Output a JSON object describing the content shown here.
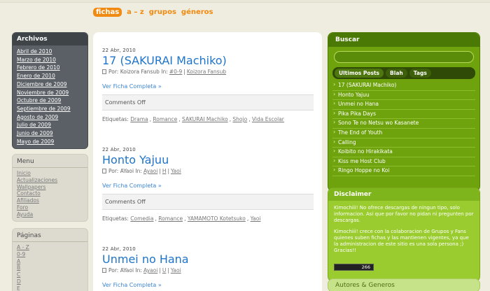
{
  "nav": [
    "fichas",
    "a – z",
    "grupos",
    "géneros"
  ],
  "archivos": {
    "title": "Archivos",
    "items": [
      "Abril de 2010",
      "Marzo de 2010",
      "Febrero de 2010",
      "Enero de 2010",
      "Diciembre de 2009",
      "Noviembre de 2009",
      "Octubre de 2009",
      "Septiembre de 2009",
      "Agosto de 2009",
      "Julio de 2009",
      "Junio de 2009",
      "Mayo de 2009"
    ]
  },
  "menu": {
    "title": "Menu",
    "items": [
      "Inicio",
      "Actualizaciones",
      "Wallpapers",
      "Contacto",
      "Afiliados",
      "Foro",
      "Ayuda"
    ]
  },
  "paginas": {
    "title": "Páginas",
    "items": [
      "A - Z",
      "0-9",
      "A",
      "B",
      "C",
      "D",
      "E"
    ]
  },
  "posts": [
    {
      "date": "22 Abr, 2010",
      "title": "17 (SAKURAI Machiko)",
      "por": "Por: Koizora Fansub In:",
      "cats": [
        "#0-9",
        "Koizora Fansub"
      ],
      "more": "Ver Ficha Completa »",
      "comments": "Comments Off",
      "etiquetas_label": "Etiquetas:",
      "tags": [
        "Drama",
        "Romance",
        "SAKURAI Machiko",
        "Shojo",
        "Vida Escolar"
      ]
    },
    {
      "date": "22 Abr, 2010",
      "title": "Honto Yajuu",
      "por": "Por: AYaoi In:",
      "cats": [
        "Ayaoi",
        "H",
        "Yaoi"
      ],
      "more": "Ver Ficha Completa »",
      "comments": "Comments Off",
      "etiquetas_label": "Etiquetas:",
      "tags": [
        "Comedia",
        "Romance",
        "YAMAMOTO Kotetsuko",
        "Yaoi"
      ]
    },
    {
      "date": "22 Abr, 2010",
      "title": "Unmei no Hana",
      "por": "Por: AYaoi In:",
      "cats": [
        "Ayaoi",
        "U",
        "Yaoi"
      ],
      "more": "Ver Ficha Completa »"
    }
  ],
  "buscar": {
    "title": "Buscar",
    "tabs": [
      "Ultimos Posts",
      "Blah",
      "Tags"
    ],
    "items": [
      "17 (SAKURAI Machiko)",
      "Honto Yajuu",
      "Unmei no Hana",
      "Pika Pika Days",
      "Sono Te no Netsu wo Kasanete",
      "The End of Youth",
      "Calling",
      "Koibito no Hirakikata",
      "Kiss me Host Club",
      "Ringo Hoppe no Koi"
    ]
  },
  "disclaimer": {
    "title": "Disclaimer",
    "p1": "Kimochiii! No ofrece descargas de ningun tipo, solo informacion. Asi que por favor no pidan ni pregunten por descargas.",
    "p2": "Kimochiii! crece con la colaboracion de Grupos y Fans quienes suben fichas y las mantienen vigentes, ya que la administracion de este sitio es una sola persona ;) Gracias!!",
    "counter": "266"
  },
  "autores": {
    "title": "Autores & Generos"
  }
}
